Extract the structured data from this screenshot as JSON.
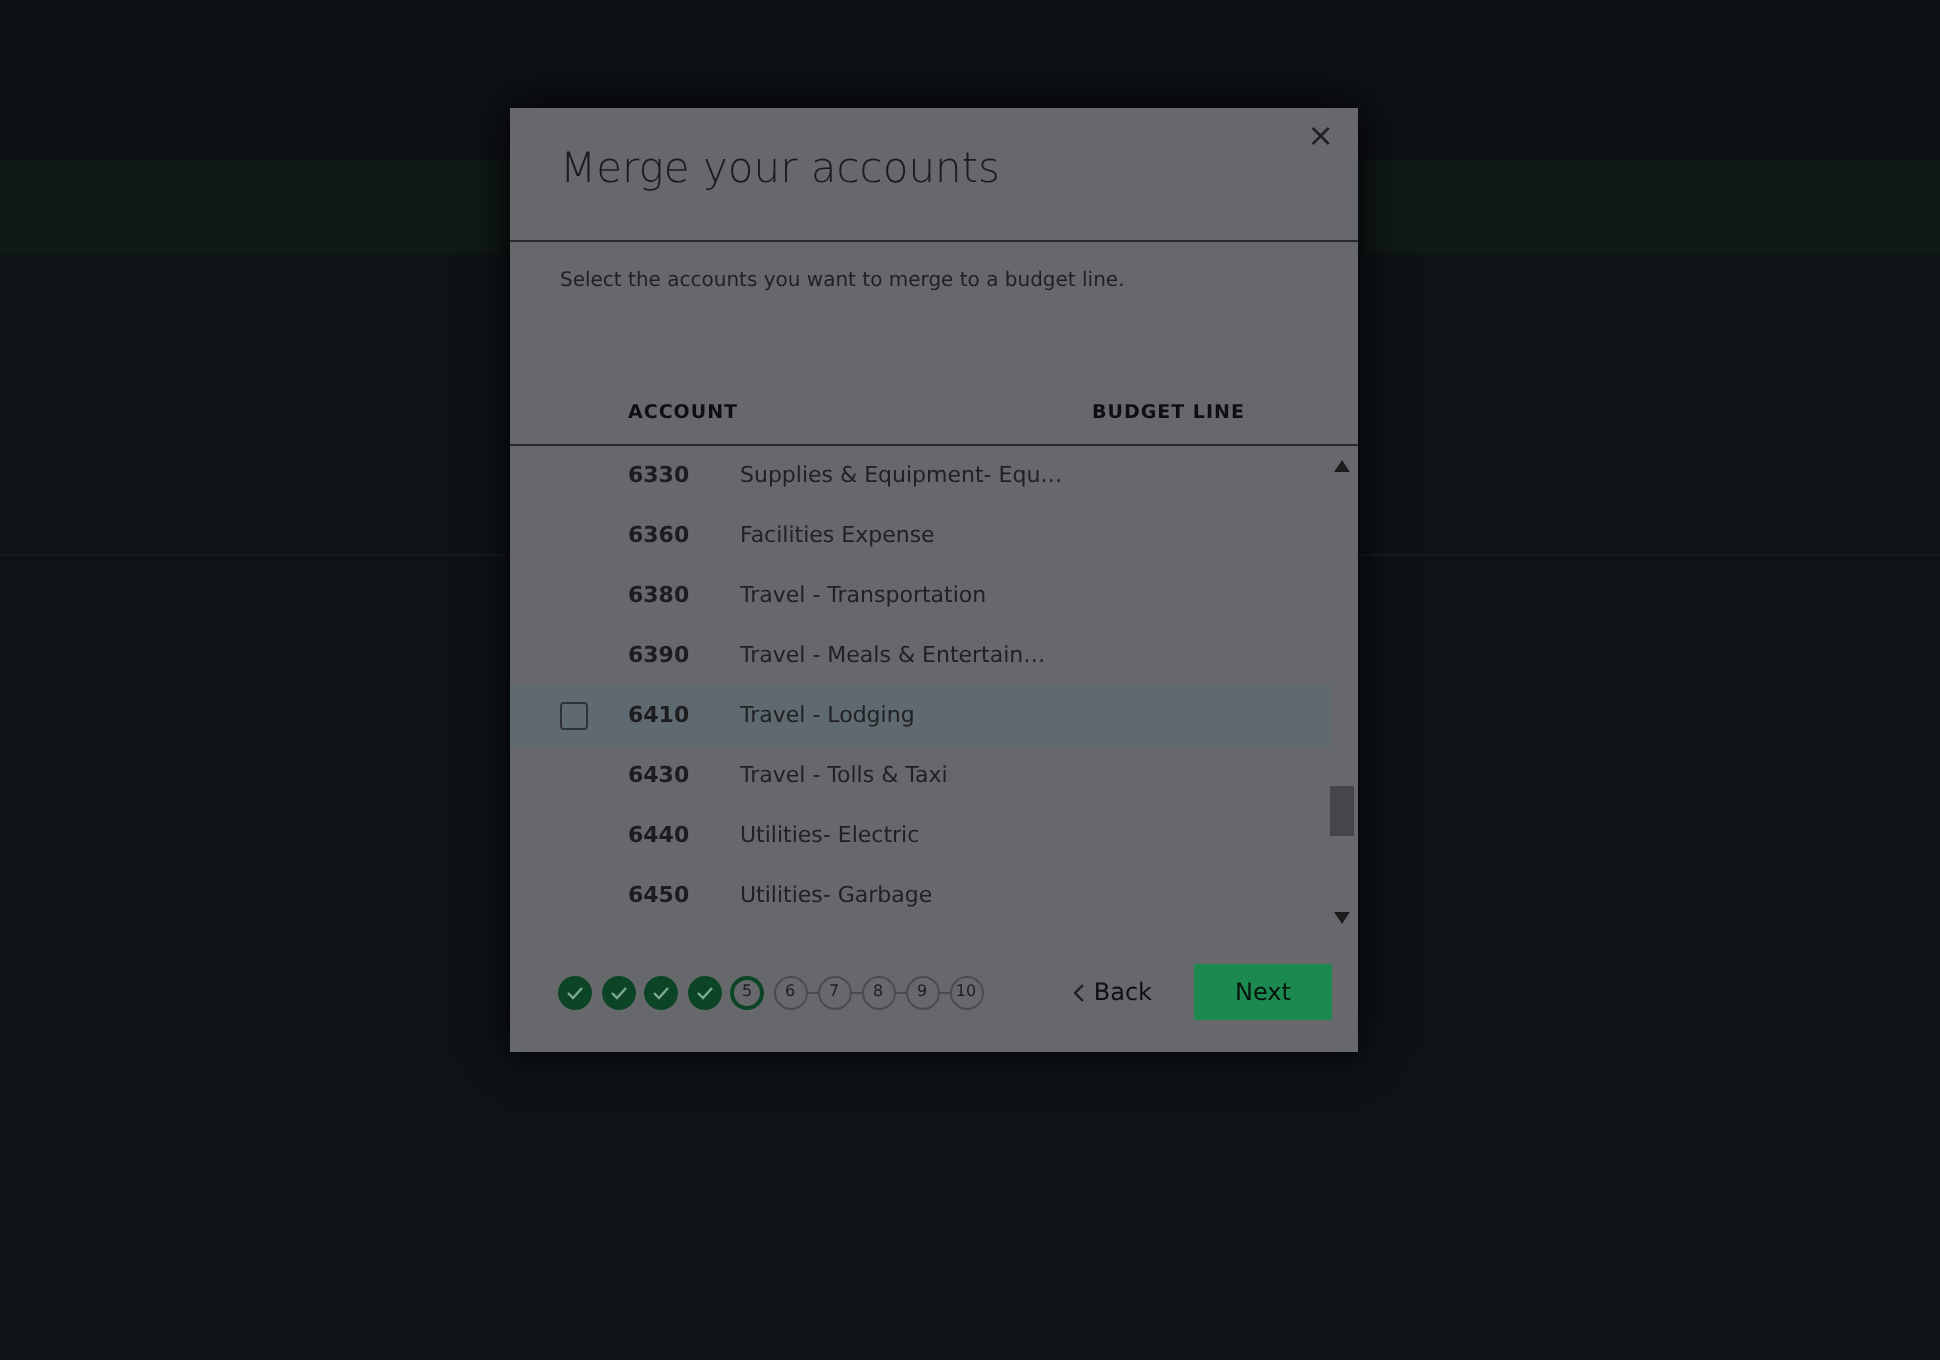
{
  "dialog": {
    "title": "Merge your accounts",
    "close": "×",
    "description": "Select the accounts you want to merge to a budget line.",
    "columns": [
      "ACCOUNT",
      "BUDGET LINE"
    ],
    "rows": [
      {
        "number": "6330",
        "name": "Supplies & Equipment- Equ…",
        "hovered": false,
        "checked": false
      },
      {
        "number": "6360",
        "name": "Facilities Expense",
        "hovered": false,
        "checked": false
      },
      {
        "number": "6380",
        "name": "Travel - Transportation",
        "hovered": false,
        "checked": false
      },
      {
        "number": "6390",
        "name": "Travel - Meals & Entertain…",
        "hovered": false,
        "checked": false
      },
      {
        "number": "6410",
        "name": "Travel - Lodging",
        "hovered": true,
        "checked": false
      },
      {
        "number": "6430",
        "name": "Travel - Tolls & Taxi",
        "hovered": false,
        "checked": false
      },
      {
        "number": "6440",
        "name": "Utilities- Electric",
        "hovered": false,
        "checked": false
      },
      {
        "number": "6450",
        "name": "Utilities- Garbage",
        "hovered": false,
        "checked": false
      }
    ],
    "steps": [
      {
        "done": true,
        "selected": false
      },
      {
        "done": true,
        "selected": false
      },
      {
        "done": true,
        "selected": false
      },
      {
        "done": true,
        "selected": false
      },
      {
        "done": false,
        "selected": true,
        "label": "5"
      },
      {
        "done": false,
        "selected": false,
        "label": "6"
      },
      {
        "done": false,
        "selected": false,
        "label": "7"
      },
      {
        "done": false,
        "selected": false,
        "label": "8"
      },
      {
        "done": false,
        "selected": false,
        "label": "9"
      },
      {
        "done": false,
        "selected": false,
        "label": "10"
      }
    ],
    "back": "Back",
    "next": "Next"
  }
}
